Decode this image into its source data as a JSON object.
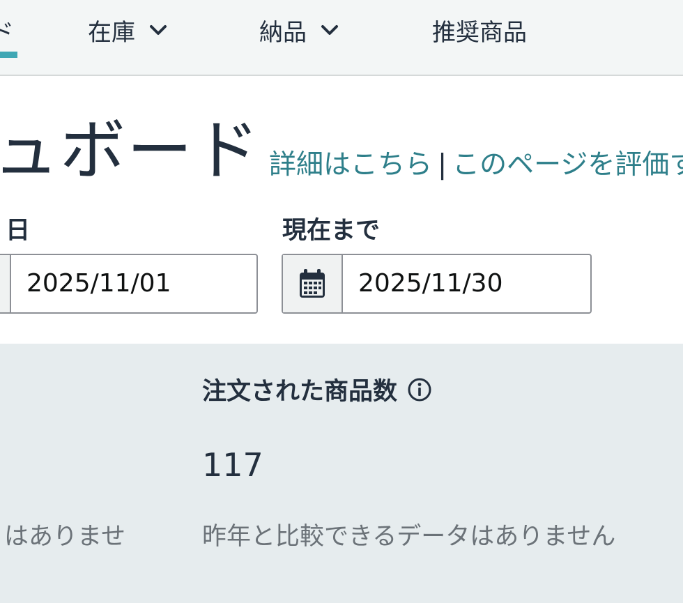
{
  "nav": {
    "partial_label": "ド",
    "items": [
      {
        "label": "在庫"
      },
      {
        "label": "納品"
      },
      {
        "label": "推奨商品"
      }
    ]
  },
  "page": {
    "title": "ュボード",
    "links": {
      "details": "詳細はこちら",
      "separator": "|",
      "rate": "このページを評価す"
    }
  },
  "date_from": {
    "label": "日",
    "value": "2025/11/01"
  },
  "date_to": {
    "label": "現在まで",
    "value": "2025/11/30"
  },
  "metrics": {
    "left_note": "はありませ",
    "ordered_units": {
      "title": "注文された商品数",
      "value": "117",
      "note": "昨年と比較できるデータはありません"
    }
  },
  "colors": {
    "accent": "#3fa7b4",
    "link": "#2e7f8a",
    "panel": "#e6ecee",
    "nav_bg": "#f3f6f6"
  }
}
